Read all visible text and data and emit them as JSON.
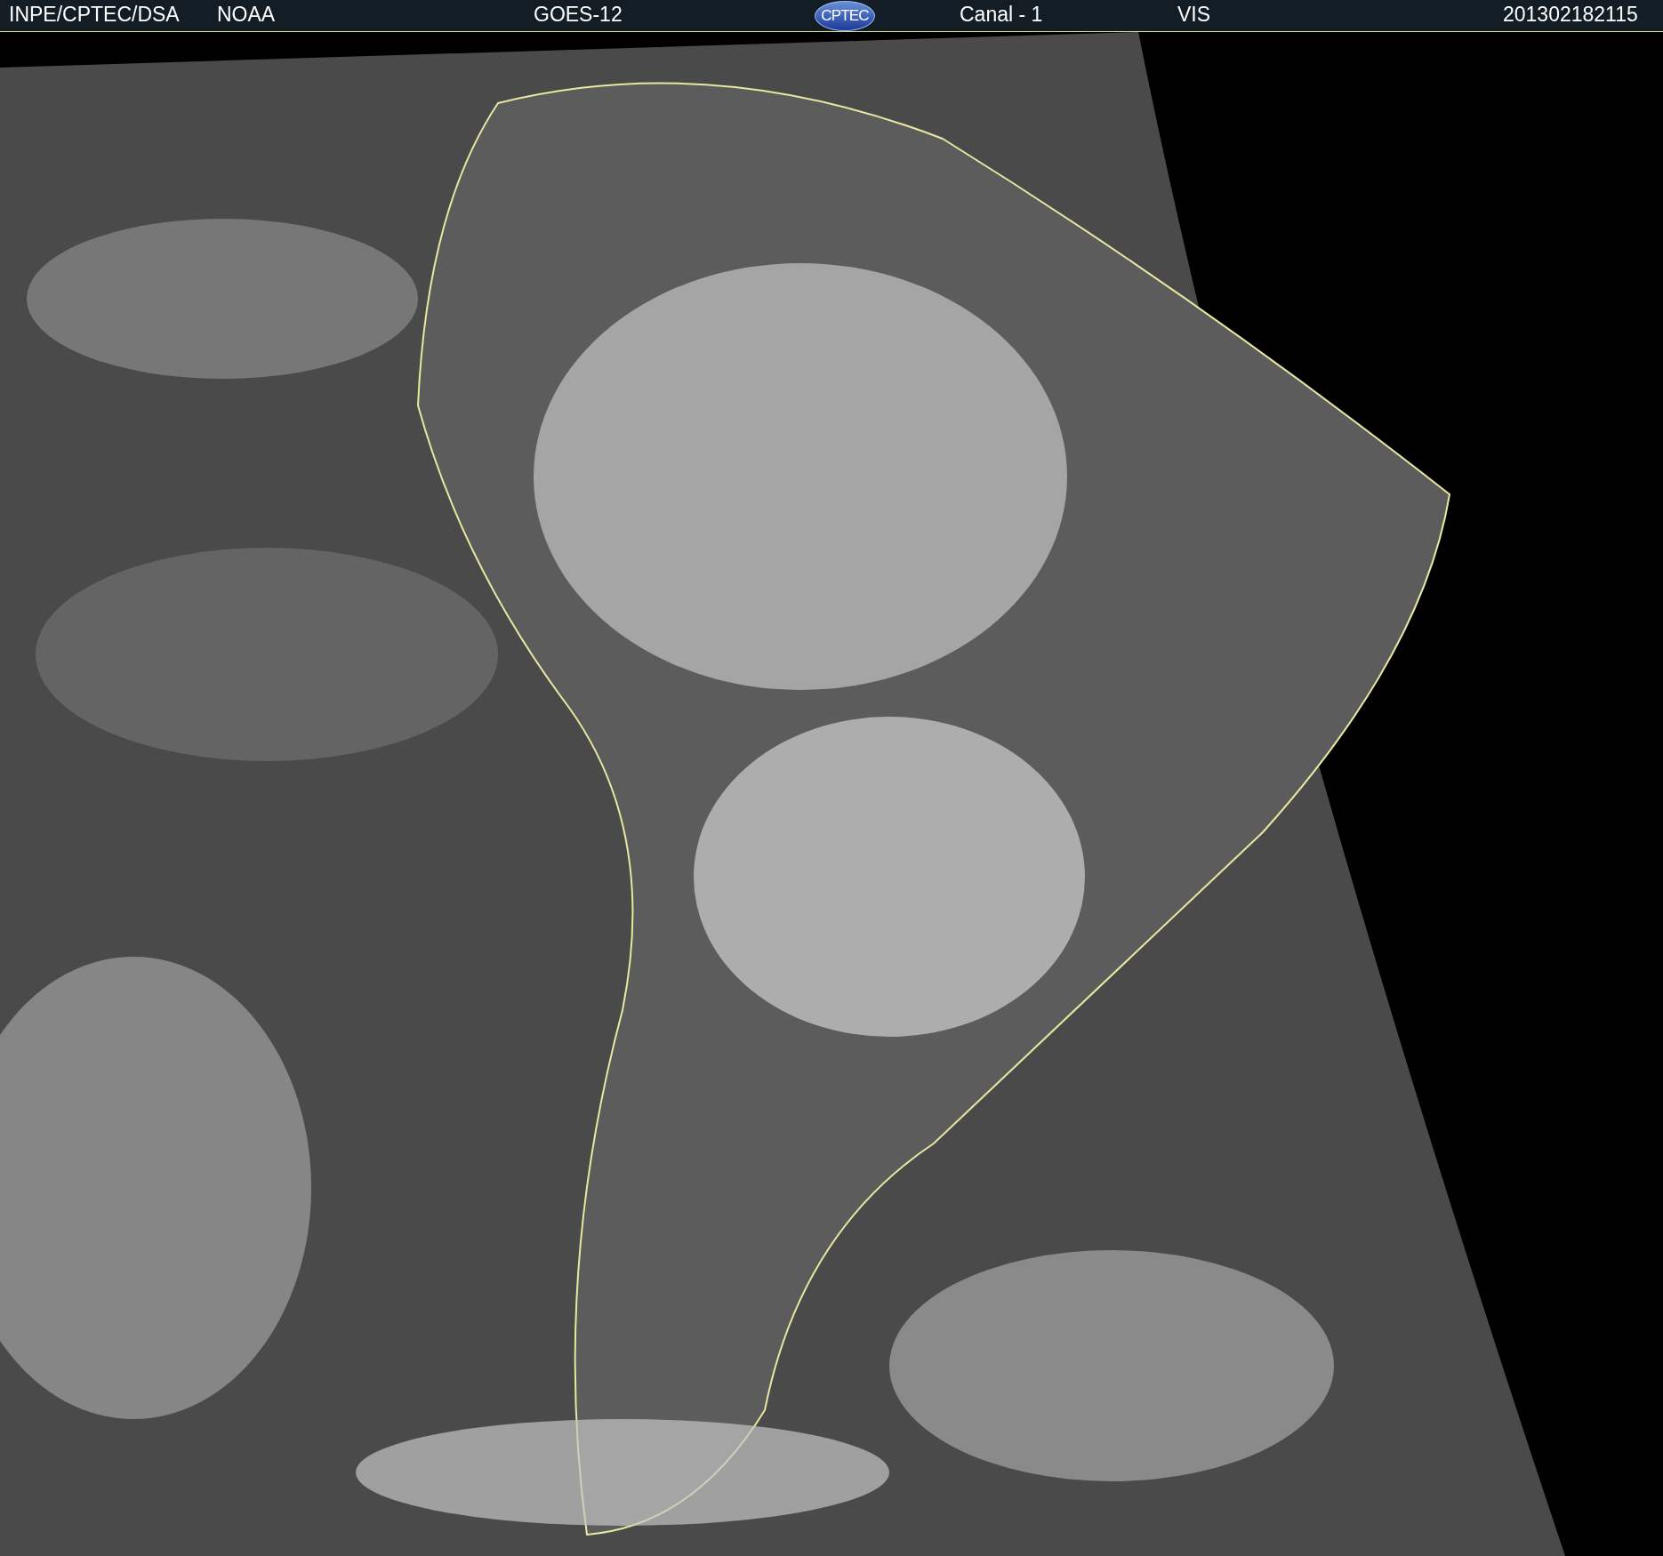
{
  "header": {
    "agency": "INPE/CPTEC/DSA",
    "source": "NOAA",
    "satellite": "GOES-12",
    "logo": "CPTEC",
    "channel": "Canal - 1",
    "band": "VIS",
    "timestamp": "201302182115"
  }
}
